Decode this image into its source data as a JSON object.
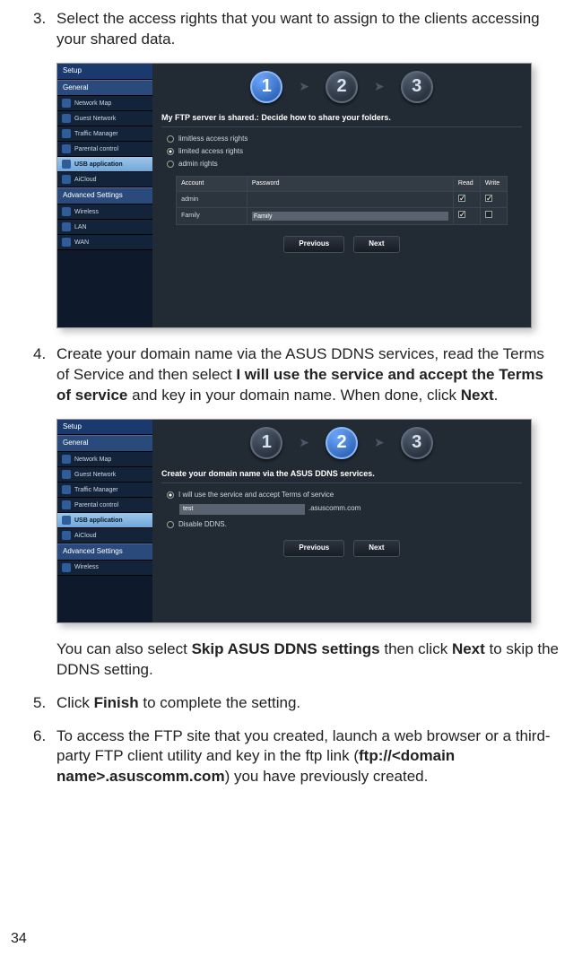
{
  "page_number": "34",
  "steps": [
    {
      "num": "3.",
      "text": "Select the access rights that you want to assign to the clients accessing your shared data."
    },
    {
      "num": "4.",
      "text_parts": [
        "Create your domain name via the ASUS DDNS services, read the Terms of Service and then select ",
        "I will use the service and accept the Terms of service",
        " and key in your domain name. When done, click ",
        "Next",
        "."
      ]
    },
    {
      "post_parts": [
        "You can also select ",
        "Skip ASUS DDNS settings",
        " then click ",
        "Next",
        " to skip the DDNS setting."
      ]
    },
    {
      "num": "5.",
      "text_parts": [
        "Click ",
        "Finish",
        " to complete the setting."
      ]
    },
    {
      "num": "6.",
      "text_parts": [
        "To access the FTP site that you created, launch a web browser or a third-party FTP client utility and key in the ftp link (",
        "ftp://<domain name>.asuscomm.com",
        ") you have previously created."
      ]
    }
  ],
  "router_ui": {
    "nav": {
      "setup": "Setup",
      "general": "General",
      "items": [
        "Network Map",
        "Guest Network",
        "Traffic Manager",
        "Parental control",
        "USB application",
        "AiCloud"
      ],
      "advanced": "Advanced Settings",
      "adv_items": [
        "Wireless",
        "LAN",
        "WAN"
      ]
    },
    "steps": [
      "1",
      "2",
      "3"
    ],
    "screen1": {
      "title": "My FTP server is shared.: Decide how to share your folders.",
      "radios": [
        "limitless access rights",
        "limited access rights",
        "admin rights"
      ],
      "table": {
        "headers": [
          "Account",
          "Password",
          "Read",
          "Write"
        ],
        "rows": [
          {
            "account": "admin",
            "password": "",
            "read": true,
            "write": true
          },
          {
            "account": "Family",
            "password": "Family",
            "read": true,
            "write": false
          }
        ]
      },
      "buttons": [
        "Previous",
        "Next"
      ]
    },
    "screen2": {
      "title": "Create your domain name via the ASUS DDNS services.",
      "radio1": "I will use the service and accept Terms of service",
      "input_value": "test",
      "suffix": ".asuscomm.com",
      "radio2": "Disable DDNS.",
      "buttons": [
        "Previous",
        "Next"
      ]
    }
  }
}
